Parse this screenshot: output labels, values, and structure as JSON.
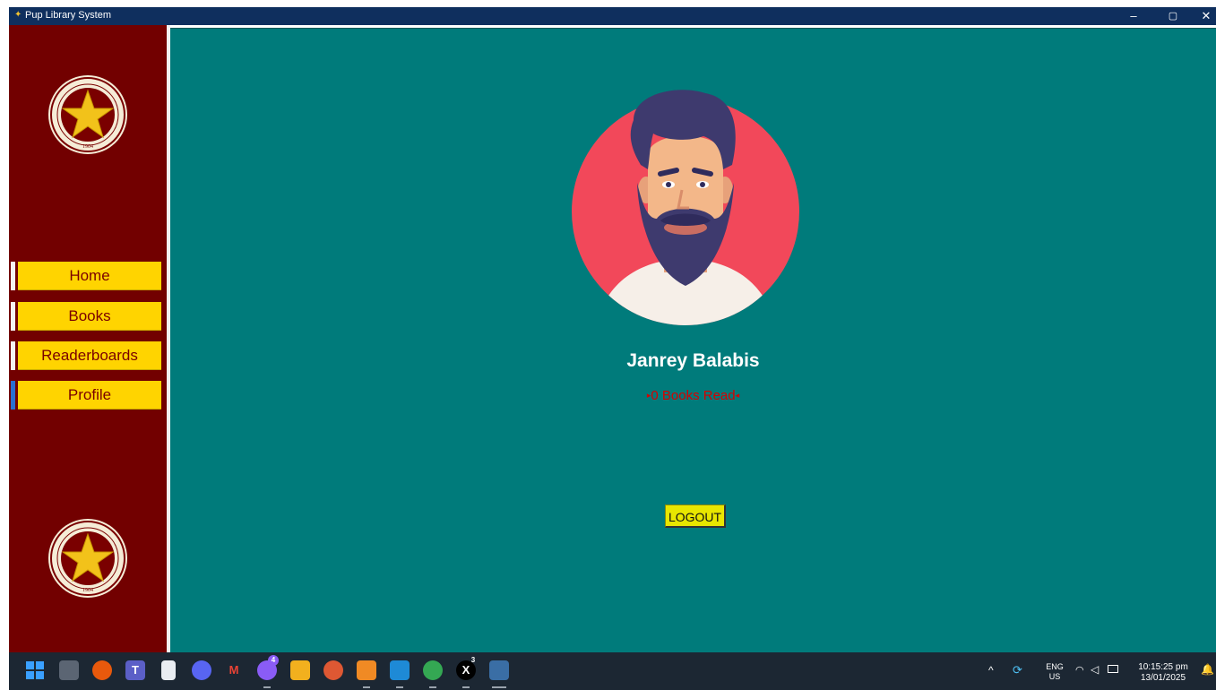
{
  "window": {
    "title": "Pup Library System",
    "controls": [
      "–",
      "▢",
      "✕"
    ]
  },
  "sidebar": {
    "items": [
      {
        "label": "Home",
        "active": false
      },
      {
        "label": "Books",
        "active": false
      },
      {
        "label": "Readerboards",
        "active": false
      },
      {
        "label": "Profile",
        "active": true
      }
    ]
  },
  "profile": {
    "name": "Janrey Balabis",
    "books_read": "0 Books Read",
    "logout_label": "LOGOUT"
  },
  "taskbar": {
    "apps": [
      "windows-start",
      "task-view",
      "brave",
      "teams",
      "notepad",
      "discord",
      "gmail",
      "messenger",
      "file-explorer",
      "duckduckgo",
      "app-orange",
      "vscode",
      "chrome",
      "x",
      "python"
    ],
    "messenger_badge": "4",
    "x_badge": "3",
    "language_line1": "ENG",
    "language_line2": "US",
    "time": "10:15:25 pm",
    "date": "13/01/2025"
  },
  "colors": {
    "sidebar_bg": "#720000",
    "main_bg": "#007b7b",
    "nav_button": "#ffd400",
    "nav_text": "#7a0000",
    "books_read_text": "#d70000",
    "logout_bg": "#e8e600"
  }
}
